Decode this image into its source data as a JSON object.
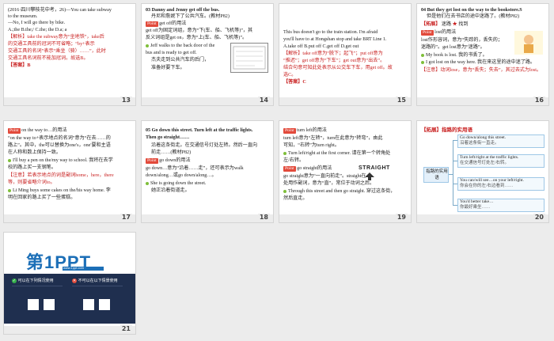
{
  "slides": [
    {
      "number": "13",
      "lines": [
        "(2016·四川攀枝花中考，26)—You can take subway",
        "to the museum.",
        "—No, I will go there by  bike.",
        "A.;the        B.the;/        C.the; the        D.a; a",
        "【解析】take the subway意为“坐地铁”，take后",
        "的交通工具前的冠词不可省略；“by+表示",
        "交通工具的名词”表示“乘坐（骑）……”，此时",
        "交通工具名词前不能加冠词。故选B。",
        "【答案】B"
      ]
    },
    {
      "number": "14",
      "lines": [
        "03  Danny and Jenny get off the bus.",
        "丹尼和詹妮下了公共汽车。(教材P82)",
        "get off的用法",
        "get off为固定词组，意为“下(车、船、飞机等)”，其",
        "反义词组是get on，意为“上(车、船、飞机等)”。",
        "Jeff walks to the back door of the",
        "bus and is ready to get off.",
        "杰夫走到公共汽车的后门，",
        "准备好要下车。"
      ],
      "tag": "Point"
    },
    {
      "number": "15",
      "lines": [
        "This bus doesn't go to the train station. I'm afraid",
        "you'll have to    at Hongshan stop and take BRT Line 1.",
        "A.take off        B.put off        C.get off        D.get out",
        "【解析】take off意为“脱下；起飞”；put off意为",
        "“推迟”；get off意为“下车”；get out意为“出去”。",
        "结合句意可知此处表示从公交车下车，用get off。故",
        "选C。",
        "【答案】C"
      ]
    },
    {
      "number": "16",
      "lines": [
        "04  But they get lost on the way to the bookstore.S",
        "但是他们在去书店的途中迷路了。(教材P82)",
        "lost的用法",
        "lost作形容词，意为“失踪的，丢失的；",
        "迷路的”。get lost意为“迷路”。",
        "My book is lost. 我的书丢了。",
        "I got lost on the way here. 我在来这里的途中迷了路。",
        "【注意】动词lose，意为“丢失；失去”，其过去式为lost。"
      ],
      "tag": "Point",
      "note_tag": "【拓展】",
      "note_words": [
        "迷路",
        "★",
        "找到"
      ]
    },
    {
      "number": "17",
      "lines": [
        "on the way to…的用法",
        "“on the way to+表示地点的名词”意为“在去……的",
        "路上”。其中，the可以替换为one's，one'要和主语",
        "在人称和数上保持一致。",
        "I'll buy a pen on the/my way to school. 我将在去学",
        "校的路上买一支钢笔。",
        "【注意】若表示地点的词是副词home，here，there",
        "等，则要省略介词to。",
        "Li Ming buys some cakes on the/his way home. 李",
        "明在回家的路上买了一些蛋糕。"
      ],
      "tag": "Point"
    },
    {
      "number": "18",
      "lines": [
        "05  Go down this street. Turn left at the traffic lights.",
        "Then go straight……",
        "沿着这条街走。在交通信号灯处左转。然后一直向",
        "前走……(教材P82)",
        "go down的用法",
        "go down…意为“沿着……走”，还可表示为walk",
        "down/along…或go down/along…。",
        "She is going down the street.",
        "她正沿着街道走。"
      ],
      "tag": "Point"
    },
    {
      "number": "19",
      "lines": [
        "turn left的用法",
        "turn left意为“左转”，turn在此意为“转弯”，由此",
        "可知，“右转”为turn right。",
        "Turn left/right at the first corner. 请在第一个转角处",
        "左/右转。",
        "go straight的用法",
        "go straight意为“一直向前走”。straight在",
        "处用作副词，意为“直”，常位于动词之后。",
        "Through this street and then go straight. 穿过这条街，",
        "然后直走。"
      ],
      "tag": "Point",
      "straight_word": "STRAIGHT"
    },
    {
      "number": "20",
      "heading": "【拓展】指路的实用语",
      "center_label": "指路的实用语",
      "branches": [
        {
          "en": "Go down/along this street.",
          "zh": "沿着这条街一直走。"
        },
        {
          "en": "Turn left/right at the traffic lights.",
          "zh": "在交通信号灯处左/右转。"
        },
        {
          "en": "You can/will see…on your left/right.",
          "zh": "你会在你的左/右边看到……"
        },
        {
          "en": "You'd better take…",
          "zh": "你最好乘坐……"
        }
      ]
    },
    {
      "number": "21",
      "logo": "第1PPT",
      "logo_sub": "www.1ppt.com",
      "band": [
        "可以在下列情况使用",
        "不可以在以下情景使用"
      ]
    }
  ],
  "colors": {
    "accent_red": "#c81e1e",
    "tag_red": "#e24a3b",
    "logo_blue": "#1c6fb7",
    "band_navy": "#1f2f4f"
  }
}
